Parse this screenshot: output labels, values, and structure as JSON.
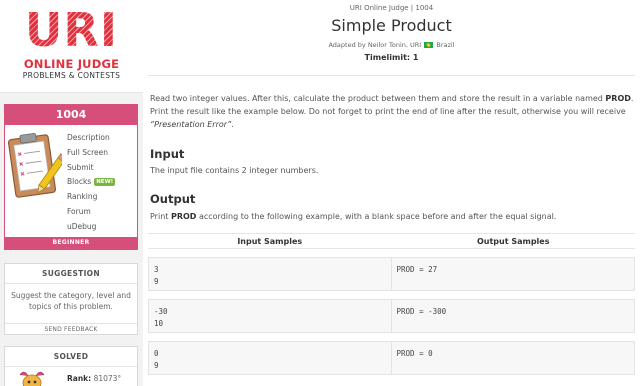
{
  "logo": {
    "title": "URI",
    "subtitle": "ONLINE JUDGE",
    "tagline": "PROBLEMS & CONTESTS"
  },
  "problem_card": {
    "id": "1004",
    "menu": {
      "description": "Description",
      "full_screen": "Full Screen",
      "submit": "Submit",
      "blocks": "Blocks",
      "blocks_badge": "NEW!",
      "ranking": "Ranking",
      "forum": "Forum",
      "udebug": "uDebug"
    },
    "level": "BEGINNER"
  },
  "suggestion": {
    "title": "SUGGESTION",
    "text": "Suggest the category, level and topics of this problem.",
    "button": "SEND FEEDBACK"
  },
  "solved": {
    "title": "SOLVED",
    "rank_label": "Rank:",
    "rank_value": "81073°"
  },
  "header": {
    "judge": "URI Online Judge | 1004",
    "title": "Simple Product",
    "adapted_prefix": "Adapted by Neilor Tonin, URI",
    "country": "Brazil",
    "timelimit": "Timelimit: 1"
  },
  "statement": {
    "p1": "Read two integer values. After this, calculate the product between them and store the result in a variable named ",
    "var": "PROD",
    "p2": ". Print the result like the example below. Do not forget to print the end of line after the result, otherwise you will receive ",
    "err": "“Presentation Error”",
    "p3": "."
  },
  "input": {
    "title": "Input",
    "text": "The input file contains 2 integer numbers."
  },
  "output": {
    "title": "Output",
    "text_pre": "Print ",
    "var": "PROD",
    "text_post": " according to the following example, with a blank space before and after the equal signal."
  },
  "samples": {
    "input_header": "Input Samples",
    "output_header": "Output Samples",
    "rows": [
      {
        "input": "3\n9",
        "output": "PROD = 27"
      },
      {
        "input": "-30\n10",
        "output": "PROD = -300"
      },
      {
        "input": "0\n9",
        "output": "PROD = 0"
      }
    ]
  },
  "colors": {
    "brand_red": "#e0323e",
    "problem_pink": "#d64f7a",
    "badge_green": "#7ab541"
  }
}
